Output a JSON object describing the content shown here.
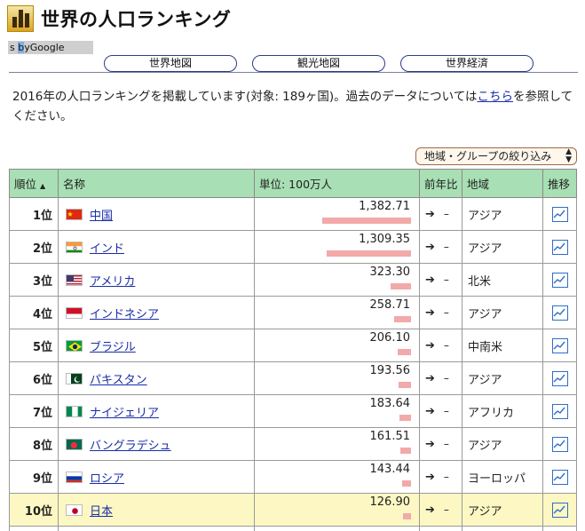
{
  "header": {
    "title": "世界の人口ランキング"
  },
  "translate": {
    "prefix": "s ",
    "by": "b",
    "label": "yGoogle"
  },
  "nav": [
    {
      "label": "世界地図"
    },
    {
      "label": "観光地図"
    },
    {
      "label": "世界経済"
    }
  ],
  "description": {
    "before": "2016年の人口ランキングを掲載しています(対象: 189ヶ国)。過去のデータについては",
    "link": "こちら",
    "after": "を参照してください。"
  },
  "filter": {
    "label": "地域・グループの絞り込み"
  },
  "table": {
    "columns": {
      "rank": "順位",
      "sort_indicator": "▲",
      "name": "名称",
      "unit": "単位: 100万人",
      "yoy": "前年比",
      "region": "地域",
      "trend": "推移"
    },
    "rows": [
      {
        "rank": "1位",
        "name": "中国",
        "value": "1,382.71",
        "pop": 1382.71,
        "yoy": "–",
        "region": "アジア",
        "flag": "cn"
      },
      {
        "rank": "2位",
        "name": "インド",
        "value": "1,309.35",
        "pop": 1309.35,
        "yoy": "–",
        "region": "アジア",
        "flag": "in"
      },
      {
        "rank": "3位",
        "name": "アメリカ",
        "value": "323.30",
        "pop": 323.3,
        "yoy": "–",
        "region": "北米",
        "flag": "us"
      },
      {
        "rank": "4位",
        "name": "インドネシア",
        "value": "258.71",
        "pop": 258.71,
        "yoy": "–",
        "region": "アジア",
        "flag": "id"
      },
      {
        "rank": "5位",
        "name": "ブラジル",
        "value": "206.10",
        "pop": 206.1,
        "yoy": "–",
        "region": "中南米",
        "flag": "br"
      },
      {
        "rank": "6位",
        "name": "パキスタン",
        "value": "193.56",
        "pop": 193.56,
        "yoy": "–",
        "region": "アジア",
        "flag": "pk"
      },
      {
        "rank": "7位",
        "name": "ナイジェリア",
        "value": "183.64",
        "pop": 183.64,
        "yoy": "–",
        "region": "アフリカ",
        "flag": "ng"
      },
      {
        "rank": "8位",
        "name": "バングラデシュ",
        "value": "161.51",
        "pop": 161.51,
        "yoy": "–",
        "region": "アジア",
        "flag": "bd"
      },
      {
        "rank": "9位",
        "name": "ロシア",
        "value": "143.44",
        "pop": 143.44,
        "yoy": "–",
        "region": "ヨーロッパ",
        "flag": "ru"
      },
      {
        "rank": "10位",
        "name": "日本",
        "value": "126.90",
        "pop": 126.9,
        "yoy": "–",
        "region": "アジア",
        "flag": "jp",
        "highlight": true
      }
    ]
  },
  "colors": {
    "header_bg": "#a8dfb4",
    "highlight_row": "#fdf8c3",
    "bar": "#f3a9a9",
    "link": "#1a2da8",
    "nav_border": "#2b3a8f"
  },
  "icons": {
    "logo": "bar-chart-logo-icon",
    "yoy": "arrow-right-icon",
    "trend": "line-chart-icon"
  }
}
